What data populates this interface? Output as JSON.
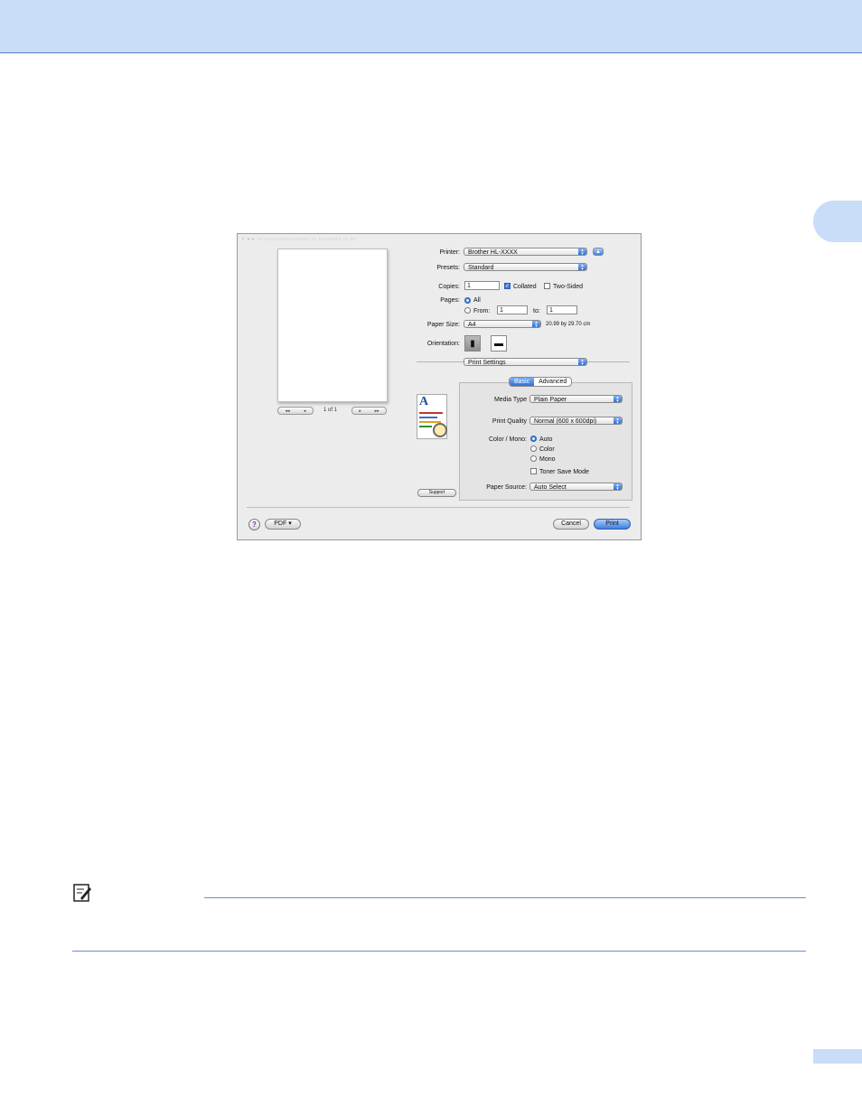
{
  "dialog": {
    "printer": {
      "label": "Printer:",
      "value": "Brother HL-XXXX"
    },
    "presets": {
      "label": "Presets:",
      "value": "Standard"
    },
    "copies": {
      "label": "Copies:",
      "value": "1",
      "collated_label": "Collated",
      "collated_checked": true,
      "two_sided_label": "Two-Sided",
      "two_sided_checked": false
    },
    "pages": {
      "label": "Pages:",
      "all_label": "All",
      "from_label": "From:",
      "from_value": "1",
      "to_label": "to:",
      "to_value": "1",
      "selected": "All"
    },
    "paper_size": {
      "label": "Paper Size:",
      "value": "A4",
      "dimensions": "20.99 by 29.70 cm"
    },
    "orientation": {
      "label": "Orientation:",
      "selected": "portrait"
    },
    "panel_menu": "Print Settings",
    "tabs": [
      "Basic",
      "Advanced"
    ],
    "selected_tab": "Basic",
    "media_type": {
      "label": "Media Type",
      "value": "Plain Paper"
    },
    "print_quality": {
      "label": "Print Quality",
      "value": "Normal (600 x 600dpi)"
    },
    "color_mono": {
      "label": "Color / Mono:",
      "options": [
        "Auto",
        "Color",
        "Mono"
      ],
      "selected": "Auto"
    },
    "toner_save": {
      "label": "Toner Save Mode",
      "checked": false
    },
    "paper_source": {
      "label": "Paper Source:",
      "value": "Auto Select"
    },
    "support_label": "Support",
    "preview": {
      "page_count": "1 of 1"
    },
    "pdf_label": "PDF ▾",
    "cancel_label": "Cancel",
    "print_label": "Print",
    "help_label": "?"
  },
  "colors": {
    "header_band": "#c9dcf8",
    "rule": "#6f8fd0",
    "accent": "#3d7fe0"
  },
  "icons": [
    "help-icon",
    "note-pencil-icon",
    "printer-eject-icon",
    "portrait-icon",
    "landscape-icon"
  ]
}
